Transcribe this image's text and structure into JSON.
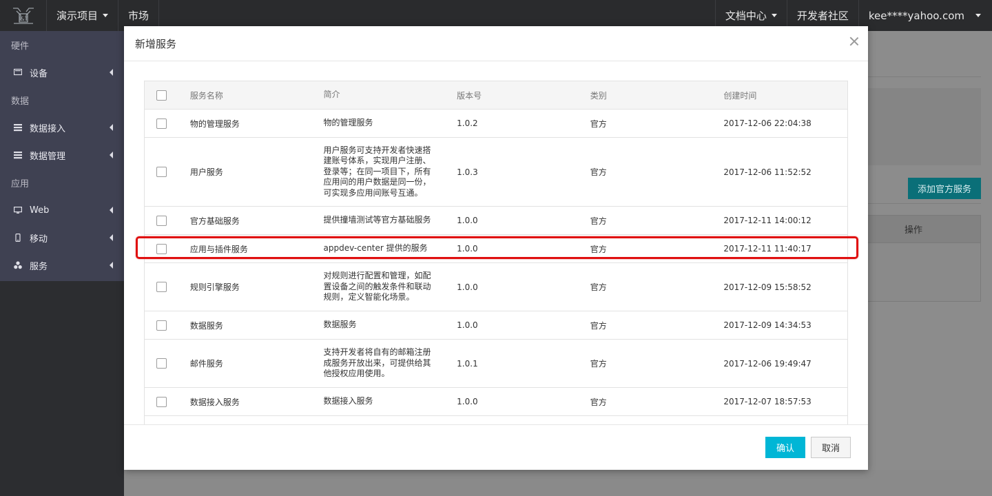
{
  "topbar": {
    "project_label": "演示项目",
    "market_label": "市场",
    "docs_label": "文档中心",
    "dev_community_label": "开发者社区",
    "user_label": "kee****yahoo.com"
  },
  "sidebar": {
    "groups": [
      {
        "label": "硬件"
      },
      {
        "label": "数据"
      },
      {
        "label": "应用"
      }
    ],
    "items": [
      {
        "label": "设备",
        "icon": "monitor-icon"
      },
      {
        "label": "数据接入",
        "icon": "list-icon"
      },
      {
        "label": "数据管理",
        "icon": "list-icon"
      },
      {
        "label": "Web",
        "icon": "desktop-icon"
      },
      {
        "label": "移动",
        "icon": "mobile-icon"
      },
      {
        "label": "服务",
        "icon": "cubes-icon"
      }
    ]
  },
  "background": {
    "add_official_service_label": "添加官方服务",
    "operation_header": "操作"
  },
  "modal": {
    "title": "新增服务",
    "columns": [
      "服务名称",
      "简介",
      "版本号",
      "类别",
      "创建时间"
    ],
    "rows": [
      {
        "name": "物的管理服务",
        "desc": "物的管理服务",
        "version": "1.0.2",
        "category": "官方",
        "created": "2017-12-06 22:04:38"
      },
      {
        "name": "用户服务",
        "desc": "用户服务可支持开发者快速搭建账号体系，实现用户注册、登录等；在同一项目下，所有应用间的用户数据是同一份，可实现多应用间账号互通。",
        "version": "1.0.3",
        "category": "官方",
        "created": "2017-12-06 11:52:52"
      },
      {
        "name": "官方基础服务",
        "desc": "提供撞墙测试等官方基础服务",
        "version": "1.0.0",
        "category": "官方",
        "created": "2017-12-11 14:00:12"
      },
      {
        "name": "应用与插件服务",
        "desc": "appdev-center 提供的服务",
        "version": "1.0.0",
        "category": "官方",
        "created": "2017-12-11 11:40:17"
      },
      {
        "name": "规则引擎服务",
        "desc": "对规则进行配置和管理，如配置设备之间的触发条件和联动规则，定义智能化场景。",
        "version": "1.0.0",
        "category": "官方",
        "created": "2017-12-09 15:58:52"
      },
      {
        "name": "数据服务",
        "desc": "数据服务",
        "version": "1.0.0",
        "category": "官方",
        "created": "2017-12-09 14:34:53"
      },
      {
        "name": "邮件服务",
        "desc": "支持开发者将自有的邮箱注册成服务开放出来，可提供给其他授权应用使用。",
        "version": "1.0.1",
        "category": "官方",
        "created": "2017-12-06 19:49:47"
      },
      {
        "name": "数据接入服务",
        "desc": "数据接入服务",
        "version": "1.0.0",
        "category": "官方",
        "created": "2017-12-07 18:57:53"
      }
    ],
    "confirm_label": "确认",
    "cancel_label": "取消"
  },
  "colors": {
    "accent": "#00b6d6",
    "highlight": "#e01010",
    "topbar": "#2a2b2d",
    "sidebar": "#3f4152"
  }
}
